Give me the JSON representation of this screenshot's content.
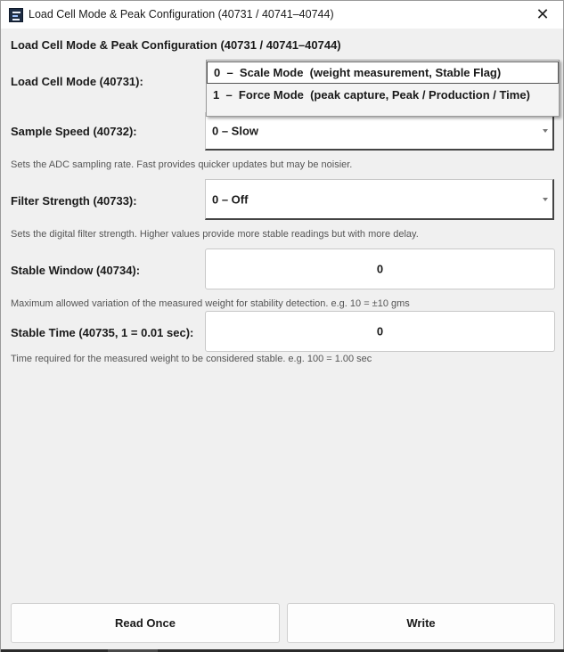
{
  "window": {
    "title": "Load Cell Mode & Peak Configuration  (40731 / 40741–40744)",
    "close_glyph": "✕",
    "app_icon": "app-icon"
  },
  "heading": "Load Cell Mode & Peak Configuration  (40731 / 40741–40744)",
  "load_cell_mode": {
    "label": "Load Cell Mode (40731):",
    "options": [
      "0  –  Scale Mode  (weight measurement, Stable Flag)",
      "1  –  Force Mode  (peak capture, Peak / Production / Time)"
    ],
    "highlighted_index": 0
  },
  "sample_speed": {
    "label": "Sample Speed (40732):",
    "value": "0 – Slow",
    "help": "Sets the ADC sampling rate. Fast provides quicker updates but may be noisier."
  },
  "filter_strength": {
    "label": "Filter Strength (40733):",
    "value": "0 – Off",
    "help": "Sets the digital filter strength. Higher values provide more stable readings but with more delay."
  },
  "stable_window": {
    "label": "Stable Window (40734):",
    "value": "0",
    "help": "Maximum allowed variation of the measured weight for stability detection. e.g. 10 = ±10 gms"
  },
  "stable_time": {
    "label": "Stable Time (40735,  1 = 0.01 sec):",
    "value": "0",
    "help": "Time required for the measured weight to be considered stable. e.g. 100 = 1.00 sec"
  },
  "buttons": {
    "read_once": "Read Once",
    "write": "Write"
  }
}
